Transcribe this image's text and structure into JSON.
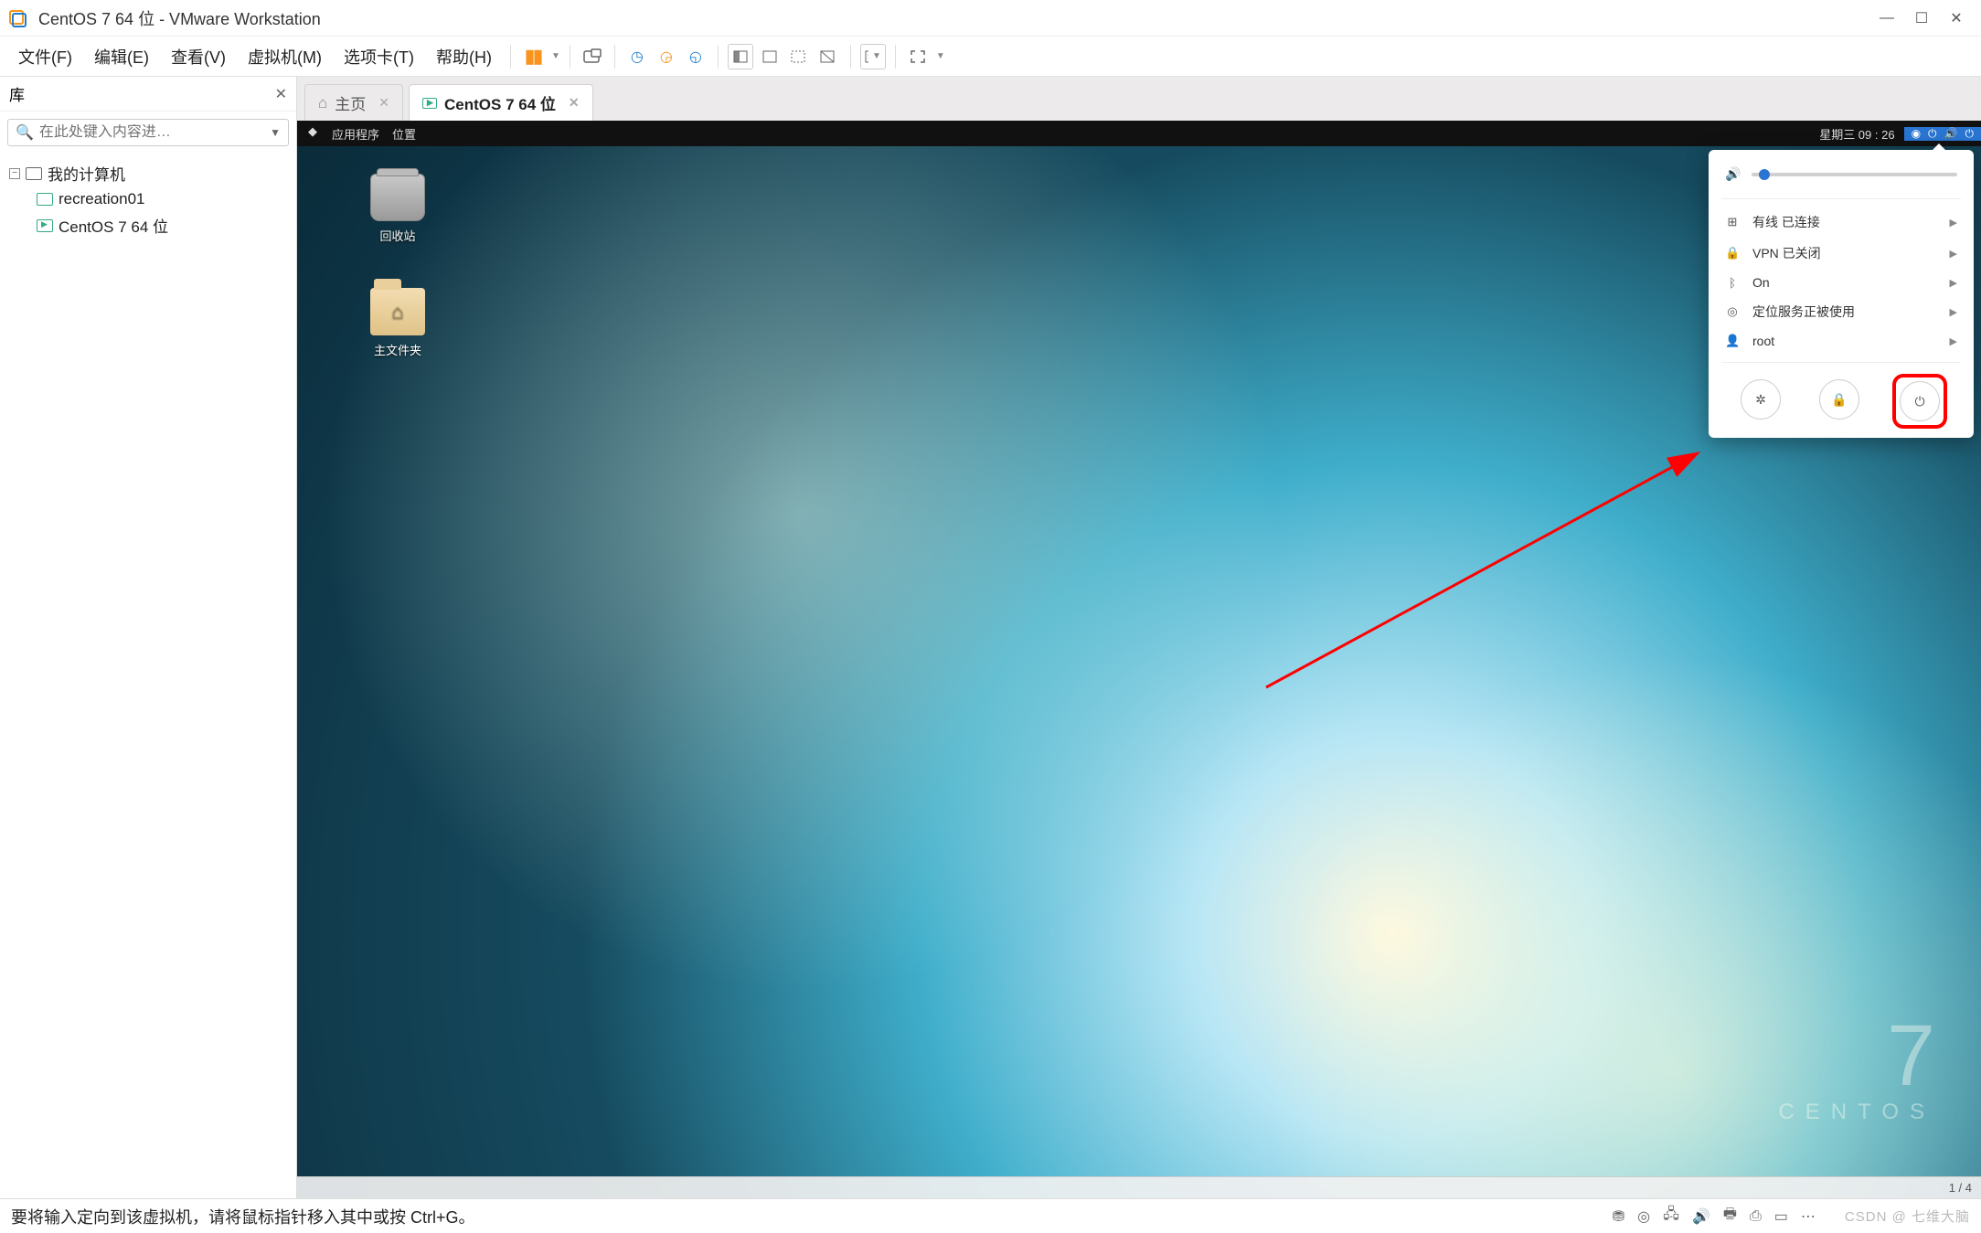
{
  "window": {
    "title": "CentOS 7 64 位 - VMware Workstation"
  },
  "menu": {
    "file": "文件(F)",
    "edit": "编辑(E)",
    "view": "查看(V)",
    "vm": "虚拟机(M)",
    "tabs": "选项卡(T)",
    "help": "帮助(H)"
  },
  "library": {
    "title": "库",
    "search_placeholder": "在此处键入内容进…",
    "root": "我的计算机",
    "items": [
      {
        "label": "recreation01",
        "running": false
      },
      {
        "label": "CentOS 7 64 位",
        "running": true
      }
    ]
  },
  "tabs": {
    "home": "主页",
    "active": "CentOS 7 64 位"
  },
  "gnome": {
    "apps": "应用程序",
    "places": "位置",
    "date": "星期三 09 : 26",
    "icons": {
      "trash": "回收站",
      "home": "主文件夹"
    },
    "brand": {
      "seven": "7",
      "name": "CENTOS"
    },
    "sysmenu": {
      "wired": "有线 已连接",
      "vpn": "VPN 已关闭",
      "bt": "On",
      "location": "定位服务正被使用",
      "user": "root"
    }
  },
  "vm_footer": {
    "pages": "1 / 4"
  },
  "host_status": {
    "hint": "要将输入定向到该虚拟机，请将鼠标指针移入其中或按 Ctrl+G。",
    "watermark": "CSDN @ 七维大脑"
  }
}
